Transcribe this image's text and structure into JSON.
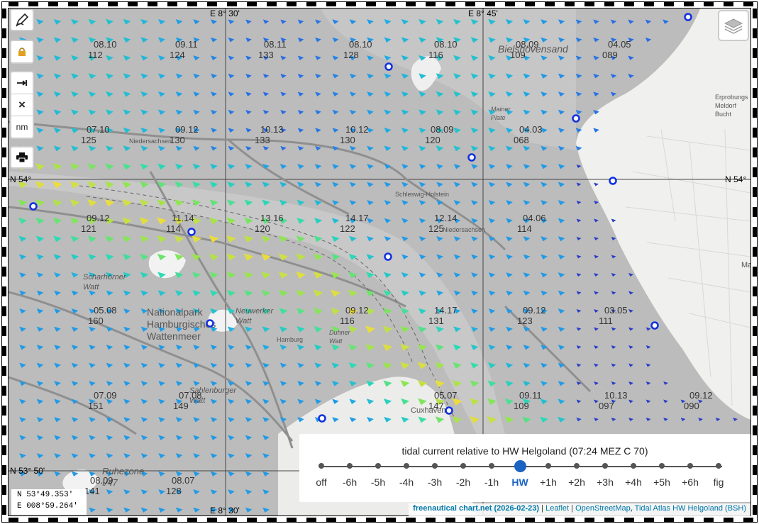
{
  "map": {
    "grid_labels": {
      "top_lon_1": "E 8° 30'",
      "top_lon_2": "E 8° 45'",
      "bottom_lon_1": "E 8° 30'",
      "left_lat_1": "N 54°",
      "right_lat_1": "N 54°",
      "left_lat_2": "N 53° 50'"
    },
    "place_names": {
      "bielshoevensand": "Bielshövensand",
      "mainer_plate": "Mainer\nPlate",
      "niedersachsen_1": "Niedersachsen",
      "schleswig_holstein": "Schleswig-Holstein",
      "niedersachsen_2": "Niedersachsen",
      "scharhorner_watt": "Scharhörner\nWatt",
      "nationalpark": "Nationalpark\nHamburgisches\nWattenmeer",
      "neuwerker_watt": "Neuwerker\nWatt",
      "duhner_watt": "Duhner\nWatt",
      "hamburg": "Hamburg",
      "cuxhaven": "Cuxhaven",
      "sahlenburger_watt": "Sahlenburger\nWatt",
      "rubezone": "Ruhezone\nI/47",
      "erprobungsstelle": "Erprobungs\nMeldorf\nBucht",
      "ma": "Ma"
    },
    "current_labels": [
      {
        "speed": "08.10",
        "dir": "112"
      },
      {
        "speed": "09.11",
        "dir": "124"
      },
      {
        "speed": "08.11",
        "dir": "133"
      },
      {
        "speed": "08.10",
        "dir": "128"
      },
      {
        "speed": "08.10",
        "dir": "116"
      },
      {
        "speed": "08.09",
        "dir": "109"
      },
      {
        "speed": "04.05",
        "dir": "089"
      },
      {
        "speed": "07.10",
        "dir": "125"
      },
      {
        "speed": "09.12",
        "dir": "130"
      },
      {
        "speed": "10.13",
        "dir": "133"
      },
      {
        "speed": "10.12",
        "dir": "130"
      },
      {
        "speed": "08.09",
        "dir": "120"
      },
      {
        "speed": "04.03",
        "dir": "068"
      },
      {
        "speed": "09.12",
        "dir": "121"
      },
      {
        "speed": "11.14",
        "dir": "114"
      },
      {
        "speed": "13.16",
        "dir": "120"
      },
      {
        "speed": "14.17",
        "dir": "122"
      },
      {
        "speed": "12.14",
        "dir": "125"
      },
      {
        "speed": "04.06",
        "dir": "114"
      },
      {
        "speed": "05.08",
        "dir": "160"
      },
      {
        "speed": "09.12",
        "dir": "116"
      },
      {
        "speed": "14.17",
        "dir": "131"
      },
      {
        "speed": "09.12",
        "dir": "123"
      },
      {
        "speed": "03.05",
        "dir": "111"
      },
      {
        "speed": "07.09",
        "dir": "151"
      },
      {
        "speed": "07.08",
        "dir": "149"
      },
      {
        "speed": "05.07",
        "dir": "147"
      },
      {
        "speed": "09.11",
        "dir": "109"
      },
      {
        "speed": "10.13",
        "dir": "097"
      },
      {
        "speed": "09.12",
        "dir": "090"
      },
      {
        "speed": "08.07",
        "dir": "128"
      },
      {
        "speed": "08.09",
        "dir": "141"
      }
    ]
  },
  "controls": {
    "draw_icon": "pencil-icon",
    "lock_icon": "lock-icon",
    "measure_icon": "arrow-right-bar-icon",
    "clear_label": "×",
    "units_label": "nm",
    "print_icon": "printer-icon",
    "layers_icon": "layers-icon"
  },
  "tide": {
    "title": "tidal current relative to HW Helgoland (07:24 MEZ C 70)",
    "steps": [
      "off",
      "-6h",
      "-5h",
      "-4h",
      "-3h",
      "-2h",
      "-1h",
      "HW",
      "+1h",
      "+2h",
      "+3h",
      "+4h",
      "+5h",
      "+6h",
      "fig"
    ],
    "active_index": 7,
    "accent": "#1a63c3"
  },
  "coords": {
    "lat": "N  53°49.353'",
    "lon": "E 008°59.264'"
  },
  "attribution": {
    "site": "freenautical chart.net (2026-02-23)",
    "sep1": " | ",
    "leaflet": "Leaflet",
    "sep2": " | ",
    "osm": "OpenStreetMap",
    "sep3": ", ",
    "atlas": "Tidal Atlas HW Helgoland (BSH)"
  }
}
